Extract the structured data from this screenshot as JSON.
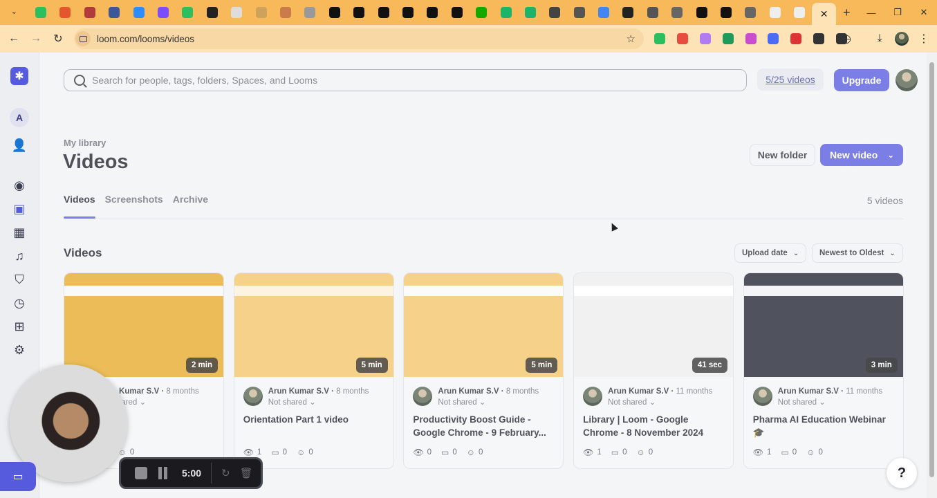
{
  "browser": {
    "url": "loom.com/looms/videos",
    "tab_icons": [
      "#2bbf5f",
      "#e4572e",
      "#b23a3a",
      "#3b5998",
      "#2d8cff",
      "#7b4dff",
      "#2bbf5f",
      "#222222",
      "#dddddd",
      "#cfa25b",
      "#c97b4a",
      "#999999",
      "#111111",
      "#111111",
      "#111111",
      "#111111",
      "#111111",
      "#111111",
      "#14a800",
      "#1eb36a",
      "#1eb36a",
      "#444444",
      "#555555",
      "#4285f4",
      "#222222",
      "#555555",
      "#666666",
      "#111111",
      "#111111",
      "#666666",
      "#eeeeee",
      "#eeeeee"
    ],
    "active_tab_icon": "✕",
    "new_tab_icon": "+",
    "extension_colors": [
      "#2bbf5f",
      "#e74c3c",
      "#b07cf2",
      "#1e9b5b",
      "#ca4dce",
      "#4a6cf7",
      "#d33",
      "#333",
      "#333"
    ]
  },
  "sidebar": {
    "workspace_initial": "A"
  },
  "header": {
    "search_placeholder": "Search for people, tags, folders, Spaces, and Looms",
    "quota": "5/25 videos",
    "upgrade_label": "Upgrade"
  },
  "page": {
    "breadcrumb": "My library",
    "title": "Videos",
    "new_folder_label": "New folder",
    "new_video_label": "New video",
    "tabs": [
      {
        "label": "Videos"
      },
      {
        "label": "Screenshots"
      },
      {
        "label": "Archive"
      }
    ],
    "count": "5 videos",
    "section_title": "Videos",
    "sort_by": "Upload date",
    "sort_order": "Newest to Oldest"
  },
  "videos": [
    {
      "duration": "2 min",
      "author": "Arun Kumar S.V",
      "ago": "8 months",
      "shared": "Not shared",
      "title": "",
      "views": "",
      "comments": "",
      "reactions": "0",
      "thumb_colors": [
        "#e6a928",
        "#f8f8f8"
      ]
    },
    {
      "duration": "5 min",
      "author": "Arun Kumar S.V",
      "ago": "8 months",
      "shared": "Not shared",
      "title": "Orientation Part 1 video",
      "views": "1",
      "comments": "0",
      "reactions": "0",
      "thumb_colors": [
        "#f2c46a",
        "#fbf1d9"
      ]
    },
    {
      "duration": "5 min",
      "author": "Arun Kumar S.V",
      "ago": "8 months",
      "shared": "Not shared",
      "title": "Productivity Boost Guide - Google Chrome - 9 February...",
      "views": "0",
      "comments": "0",
      "reactions": "0",
      "thumb_colors": [
        "#f2c46a",
        "#fafafa"
      ]
    },
    {
      "duration": "41 sec",
      "author": "Arun Kumar S.V",
      "ago": "11 months",
      "shared": "Not shared",
      "title": "Library | Loom - Google Chrome - 8 November 2024",
      "views": "1",
      "comments": "0",
      "reactions": "0",
      "thumb_colors": [
        "#eeeeee",
        "#ffffff"
      ]
    },
    {
      "duration": "3 min",
      "author": "Arun Kumar S.V",
      "ago": "11 months",
      "shared": "Not shared",
      "title": "Pharma AI Education Webinar 🎓",
      "views": "1",
      "comments": "0",
      "reactions": "0",
      "thumb_colors": [
        "#1f2230",
        "#f2f2f5"
      ]
    }
  ],
  "recorder": {
    "time": "5:00"
  },
  "help_label": "?"
}
